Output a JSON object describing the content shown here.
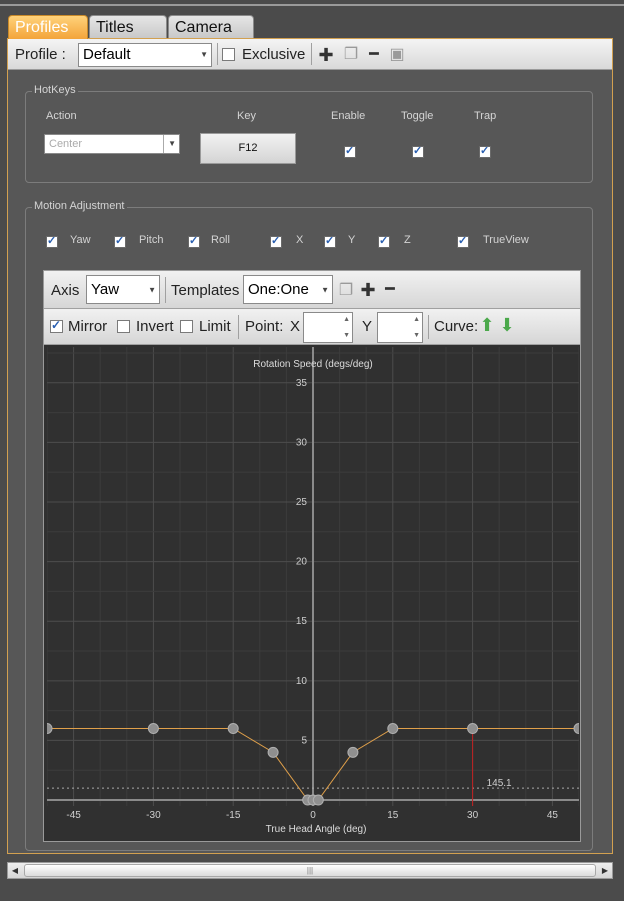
{
  "tabs": [
    {
      "label": "Profiles",
      "active": true
    },
    {
      "label": "Titles",
      "active": false
    },
    {
      "label": "Camera",
      "active": false
    }
  ],
  "toolbar": {
    "profile_label": "Profile :",
    "profile_value": "Default",
    "exclusive_label": "Exclusive",
    "exclusive_checked": false
  },
  "hotkeys": {
    "title": "HotKeys",
    "columns": {
      "action": "Action",
      "key": "Key",
      "enable": "Enable",
      "toggle": "Toggle",
      "trap": "Trap"
    },
    "action_value": "Center",
    "key_value": "F12",
    "enable": true,
    "toggle": true,
    "trap": true
  },
  "motion": {
    "title": "Motion Adjustment",
    "axes": [
      {
        "label": "Yaw",
        "checked": true
      },
      {
        "label": "Pitch",
        "checked": true
      },
      {
        "label": "Roll",
        "checked": true
      },
      {
        "label": "X",
        "checked": true
      },
      {
        "label": "Y",
        "checked": true
      },
      {
        "label": "Z",
        "checked": true
      },
      {
        "label": "TrueView",
        "checked": true
      }
    ]
  },
  "graph_toolbar": {
    "axis_label": "Axis",
    "axis_value": "Yaw",
    "templates_label": "Templates",
    "templates_value": "One:One",
    "mirror_label": "Mirror",
    "mirror_checked": true,
    "invert_label": "Invert",
    "invert_checked": false,
    "limit_label": "Limit",
    "limit_checked": false,
    "point_label": "Point:",
    "x_label": "X",
    "y_label": "Y",
    "curve_label": "Curve:"
  },
  "chart_data": {
    "type": "line",
    "title": "Rotation Speed (degs/deg)",
    "xlabel": "True Head Angle (deg)",
    "ylabel": "Rotation Speed (degs/deg)",
    "xlim": [
      -50,
      50
    ],
    "ylim": [
      -0.5,
      38
    ],
    "x_ticks": [
      "-45",
      "-30",
      "-15",
      "0",
      "15",
      "30",
      "45"
    ],
    "y_ticks": [
      "5",
      "10",
      "15",
      "20",
      "25",
      "30",
      "35"
    ],
    "series": [
      {
        "x": [
          -50,
          -30,
          -15,
          -7.5,
          -1,
          0,
          1,
          7.5,
          15,
          30,
          50
        ],
        "y": [
          6,
          6,
          6,
          4,
          0,
          0,
          0,
          4,
          6,
          6,
          6
        ]
      }
    ],
    "marker_x": 30,
    "marker_label": "145.1",
    "dotted_y": 1
  },
  "colors": {
    "accent": "#f2a33a",
    "curve": "#e0a04a",
    "marker": "#c02020",
    "plot_bg": "#303030"
  }
}
